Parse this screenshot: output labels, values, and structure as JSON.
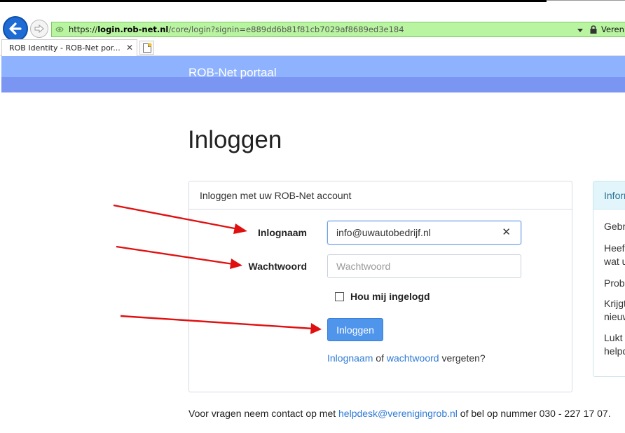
{
  "browser": {
    "address": {
      "scheme": "https://",
      "domain_prefix": "login.",
      "domain": "rob-net.nl",
      "path": "/core/login?signin=e889dd6b81f81cb7029af8689ed3e184",
      "site_label": "Vereni"
    },
    "tab": {
      "title": "ROB Identity - ROB-Net por...",
      "close_glyph": "✕"
    }
  },
  "header": {
    "brand": "ROB-Net portaal"
  },
  "page": {
    "title": "Inloggen"
  },
  "login_card": {
    "heading": "Inloggen met uw ROB-Net account",
    "username_label": "Inlognaam",
    "username_value": "info@uwautobedrijf.nl",
    "clear_glyph": "✕",
    "password_label": "Wachtwoord",
    "password_placeholder": "Wachtwoord",
    "remember_label": "Hou mij ingelogd",
    "submit_label": "Inloggen",
    "forgot": {
      "link_username": "Inlognaam",
      "or": " of ",
      "link_password": "wachtwoord",
      "suffix": " vergeten?"
    }
  },
  "info_card": {
    "heading": "Inform",
    "lines": [
      "Gebr",
      "Heef",
      "wat u",
      "Prob",
      "Krijgt",
      "nieuw",
      "Lukt",
      "helpd"
    ]
  },
  "footer": {
    "prefix": "Voor vragen neem contact op met ",
    "email": "helpdesk@verenigingrob.nl",
    "suffix": " of bel op nummer 030 - 227 17 07."
  },
  "colors": {
    "accent_blue": "#4f95ec",
    "link_blue": "#2f7bd6",
    "header_light": "#8fb2ff",
    "header_dark": "#7b95f3",
    "address_green": "#b9f5a0",
    "annotation_red": "#e01010"
  }
}
